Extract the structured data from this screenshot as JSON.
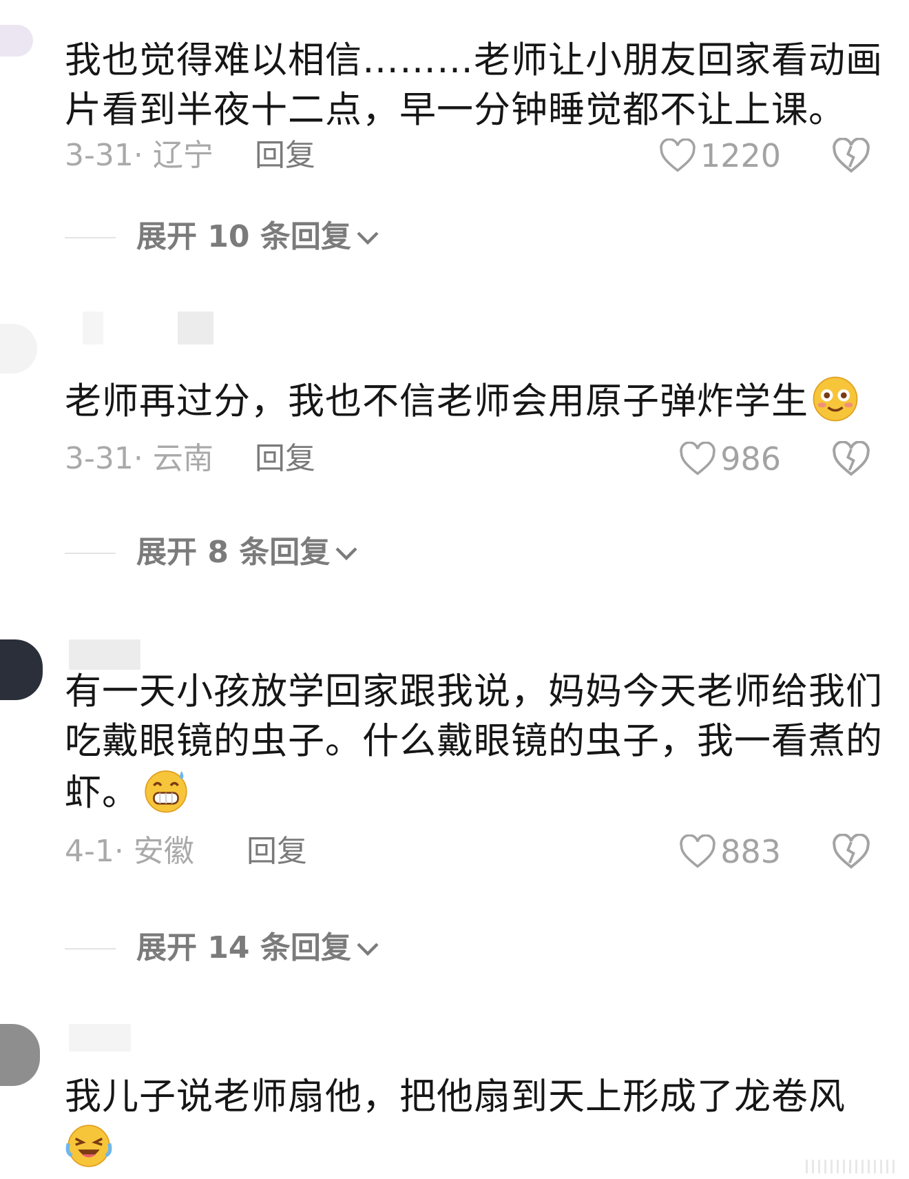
{
  "comments": [
    {
      "text": "我也觉得难以相信………老师让小朋友回家看动画片看到半夜十二点，早一分钟睡觉都不让上课。",
      "date": "3-31· 辽宁",
      "reply": "回复",
      "likes": "1220",
      "expand": "展开 10 条回复"
    },
    {
      "text": "老师再过分，我也不信老师会用原子弹炸学生",
      "emoji": "grinning-face-emoji",
      "date": "3-31· 云南",
      "reply": "回复",
      "likes": "986",
      "expand": "展开 8 条回复"
    },
    {
      "text": "有一天小孩放学回家跟我说，妈妈今天老师给我们吃戴眼镜的虫子。什么戴眼镜的虫子，我一看煮的虾。",
      "emoji": "grinning-sweat-emoji",
      "date": "4-1· 安徽",
      "reply": "回复",
      "likes": "883",
      "expand": "展开 14 条回复"
    },
    {
      "text": "我儿子说老师扇他，把他扇到天上形成了龙卷风",
      "emoji": "rolling-laughing-emoji"
    }
  ],
  "colors": {
    "text": "#161616",
    "meta": "#a9a9a9",
    "reply": "#7a7a7a",
    "expand": "#7b7b7b",
    "emoji_yellow": "#f7c53a"
  }
}
